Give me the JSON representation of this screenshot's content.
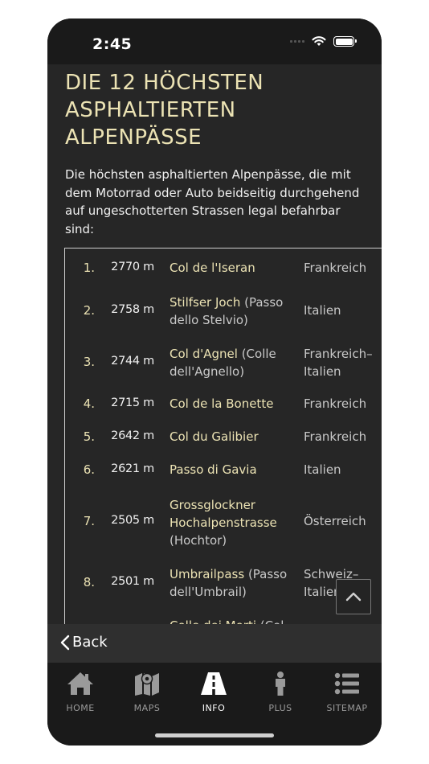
{
  "status": {
    "time": "2:45"
  },
  "page": {
    "title_lines": [
      "DIE 12 HÖCHSTEN",
      "ASPHALTIERTEN",
      "ALPENPÄSSE"
    ],
    "intro_lines": [
      "Die höchsten asphaltierten Alpenpässe, die mit",
      "dem Motorrad oder Auto beidseitig durchgehend",
      "auf ungeschotterten Strassen legal befahrbar",
      "sind:"
    ]
  },
  "passes": [
    {
      "rank": "1.",
      "altitude": "2770 m",
      "name_lines": [
        "Col de l'Iseran"
      ],
      "extra": "",
      "country_lines": [
        "Frankreich"
      ]
    },
    {
      "rank": "2.",
      "altitude": "2758 m",
      "name_lines": [
        "Stilfser Joch"
      ],
      "extra": "(Passo dello Stelvio)",
      "country_lines": [
        "Italien"
      ]
    },
    {
      "rank": "3.",
      "altitude": "2744 m",
      "name_lines": [
        "Col d'Agnel"
      ],
      "extra": "(Colle dell'Agnello)",
      "country_lines": [
        "Frankreich–",
        "Italien"
      ]
    },
    {
      "rank": "4.",
      "altitude": "2715 m",
      "name_lines": [
        "Col de la Bonette"
      ],
      "extra": "",
      "country_lines": [
        "Frankreich"
      ]
    },
    {
      "rank": "5.",
      "altitude": "2642 m",
      "name_lines": [
        "Col du Galibier"
      ],
      "extra": "",
      "country_lines": [
        "Frankreich"
      ]
    },
    {
      "rank": "6.",
      "altitude": "2621 m",
      "name_lines": [
        "Passo di Gavia"
      ],
      "extra": "",
      "country_lines": [
        "Italien"
      ]
    },
    {
      "rank": "7.",
      "altitude": "2505 m",
      "name_lines": [
        "Grossglockner",
        "Hochalpenstrasse"
      ],
      "extra": "(Hochtor)",
      "country_lines": [
        "Österreich"
      ]
    },
    {
      "rank": "8.",
      "altitude": "2501 m",
      "name_lines": [
        "Umbrailpass"
      ],
      "extra": "(Passo dell'Umbrail)",
      "country_lines": [
        "Schweiz–",
        "Italien"
      ]
    },
    {
      "rank": "",
      "altitude": "",
      "name_lines": [
        "Colle dei Morti"
      ],
      "extra": "(Col",
      "country_lines": [
        ""
      ]
    }
  ],
  "nav": {
    "back_label": "Back",
    "tabs": [
      {
        "label": "HOME",
        "icon": "home-icon"
      },
      {
        "label": "MAPS",
        "icon": "map-icon"
      },
      {
        "label": "INFO",
        "icon": "road-icon"
      },
      {
        "label": "PLUS",
        "icon": "person-icon"
      },
      {
        "label": "SITEMAP",
        "icon": "list-icon"
      }
    ]
  },
  "colors": {
    "accent": "#ECE3B4",
    "background": "#262626"
  }
}
